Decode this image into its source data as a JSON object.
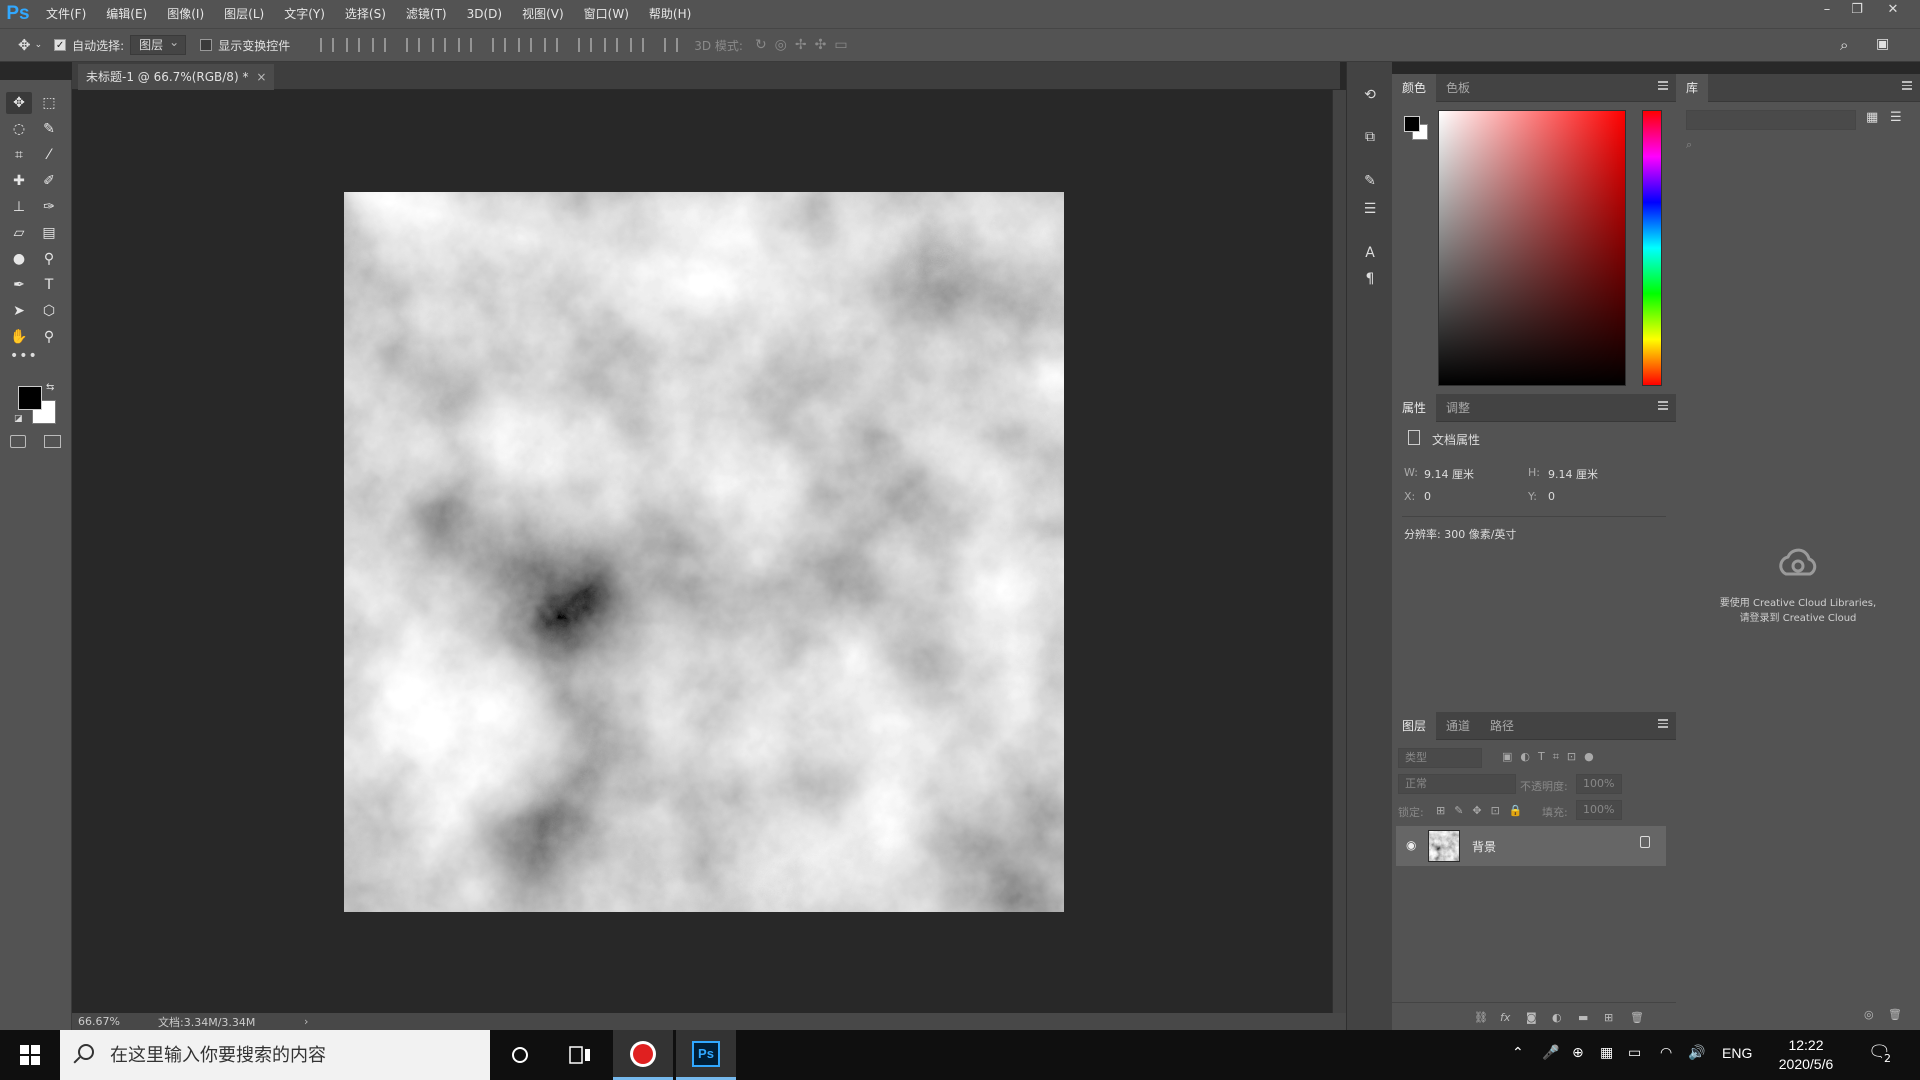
{
  "app": {
    "logo": "Ps"
  },
  "menu": [
    "文件(F)",
    "编辑(E)",
    "图像(I)",
    "图层(L)",
    "文字(Y)",
    "选择(S)",
    "滤镜(T)",
    "3D(D)",
    "视图(V)",
    "窗口(W)",
    "帮助(H)"
  ],
  "options": {
    "auto_select_label": "自动选择:",
    "auto_select_checked": true,
    "auto_select_target": "图层",
    "show_transform_label": "显示变换控件",
    "show_transform_checked": false,
    "mode_3d_label": "3D 模式:"
  },
  "document": {
    "tab_title": "未标题-1 @ 66.7%(RGB/8) *",
    "zoom_status": "66.67%",
    "doc_size_status": "文档:3.34M/3.34M"
  },
  "panels": {
    "color": {
      "tabs": [
        "颜色",
        "色板"
      ],
      "foreground": "#000000",
      "background": "#ffffff"
    },
    "properties": {
      "tabs": [
        "属性",
        "调整"
      ],
      "title": "文档属性",
      "w_label": "W:",
      "w_value": "9.14 厘米",
      "h_label": "H:",
      "h_value": "9.14 厘米",
      "x_label": "X:",
      "x_value": "0",
      "y_label": "Y:",
      "y_value": "0",
      "resolution": "分辨率: 300 像素/英寸"
    },
    "layers": {
      "tabs": [
        "图层",
        "通道",
        "路径"
      ],
      "filter_placeholder": "类型",
      "blend_mode": "正常",
      "opacity_label": "不透明度:",
      "opacity_value": "100%",
      "lock_label": "锁定:",
      "fill_label": "填充:",
      "fill_value": "100%",
      "items": [
        {
          "name": "背景",
          "visible": true,
          "locked": true
        }
      ]
    },
    "library": {
      "tab": "库",
      "message_line1": "要使用 Creative Cloud Libraries,",
      "message_line2": "请登录到 Creative Cloud"
    }
  },
  "taskbar": {
    "search_placeholder": "在这里输入你要搜索的内容",
    "language": "ENG",
    "time": "12:22",
    "date": "2020/5/6",
    "notification_count": "2"
  }
}
